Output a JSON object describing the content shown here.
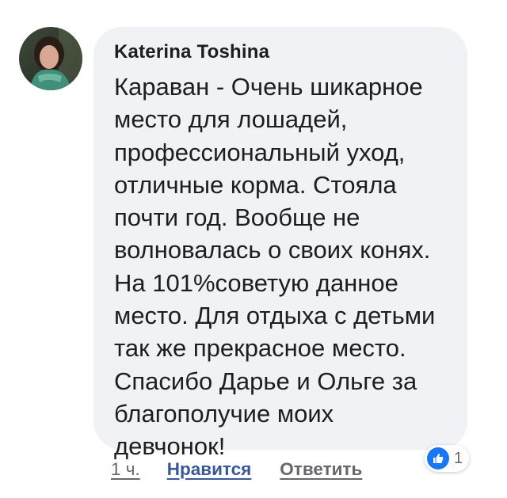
{
  "comment": {
    "author": "Katerina Toshina",
    "avatar_icon": "profile-photo",
    "text": "Караван - Очень шикарное\nместо для лошадей,\nпрофессиональный уход,\nотличные корма. Стояла\nпочти год. Вообще не\nволновалась о своих конях.\nНа 101%советую данное\nместо. Для отдыха с детьми\nтак же прекрасное место.\nСпасибо Дарье и Ольге за\nблагополучие моих\nдевчонок!"
  },
  "actions": {
    "time": "1 ч.",
    "like_label": "Нравится",
    "reply_label": "Ответить"
  },
  "reactions": {
    "icon": "thumbs-up-icon",
    "count": "1"
  },
  "colors": {
    "bubble_bg": "#f0f2f5",
    "link_blue": "#385898",
    "like_badge": "#1877f2",
    "secondary_text": "#65676b"
  }
}
